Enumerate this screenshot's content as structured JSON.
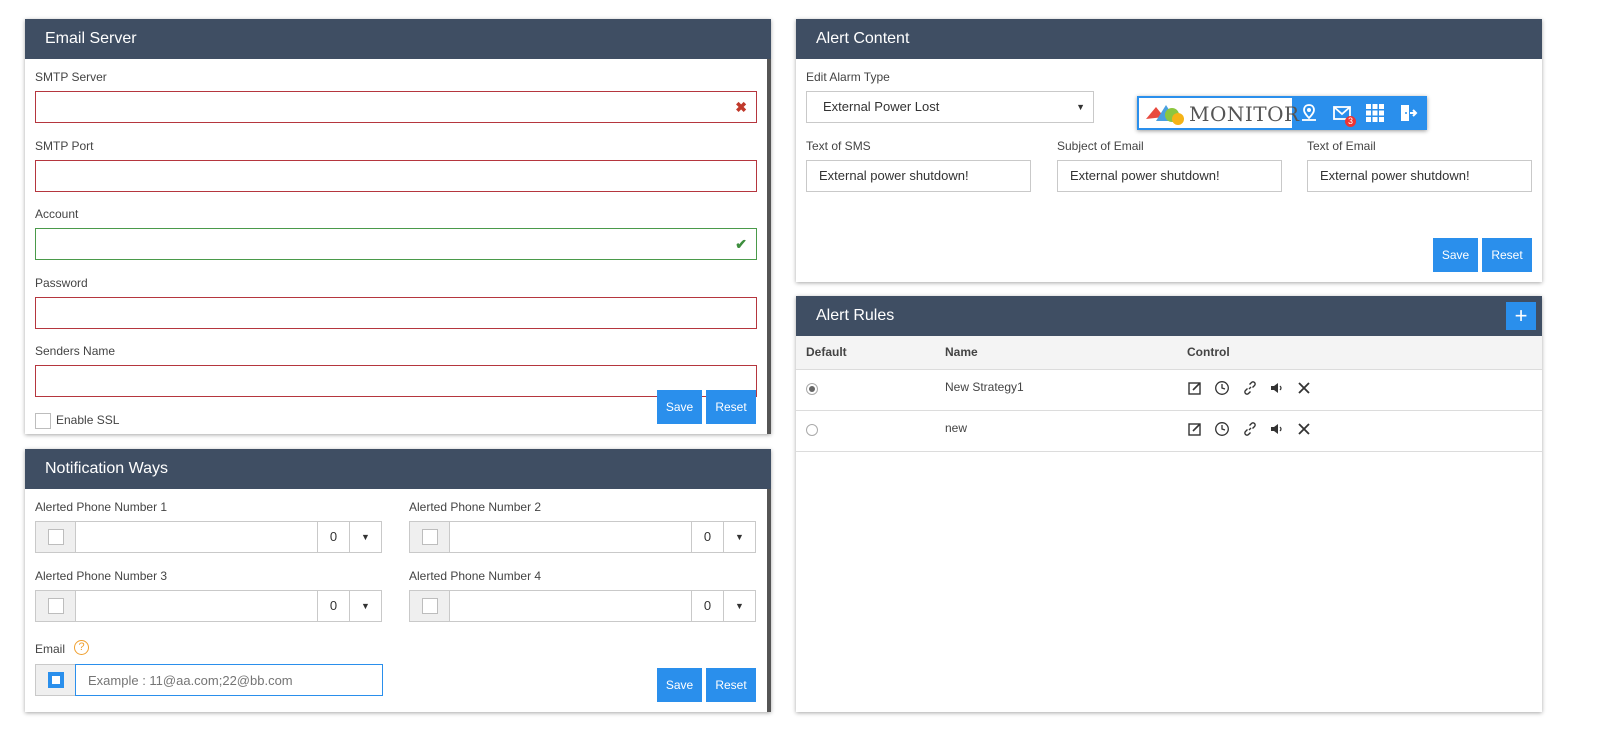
{
  "email_server": {
    "title": "Email Server",
    "fields": [
      {
        "label": "SMTP Server",
        "value": ""
      },
      {
        "label": "SMTP Port",
        "value": ""
      },
      {
        "label": "Account",
        "value": ""
      },
      {
        "label": "Password",
        "value": ""
      },
      {
        "label": "Senders Name",
        "value": ""
      }
    ],
    "ssl_label": "Enable SSL",
    "save": "Save",
    "reset": "Reset"
  },
  "notification": {
    "title": "Notification Ways",
    "phones": [
      {
        "label": "Alerted Phone Number 1",
        "value": "",
        "count": "0"
      },
      {
        "label": "Alerted Phone Number 2",
        "value": "",
        "count": "0"
      },
      {
        "label": "Alerted Phone Number 3",
        "value": "",
        "count": "0"
      },
      {
        "label": "Alerted Phone Number 4",
        "value": "",
        "count": "0"
      }
    ],
    "email_label": "Email",
    "email_help": "?",
    "email_placeholder": "Example : 11@aa.com;22@bb.com",
    "save": "Save",
    "reset": "Reset"
  },
  "alert_content": {
    "title": "Alert Content",
    "alarm_type_label": "Edit Alarm Type",
    "alarm_type_value": "External Power Lost",
    "sms_label": "Text of SMS",
    "sms_value": "External power shutdown!",
    "subject_label": "Subject of Email",
    "subject_value": "External power shutdown!",
    "email_text_label": "Text of Email",
    "email_text_value": "External power shutdown!",
    "save": "Save",
    "reset": "Reset"
  },
  "monitor_toolbar": {
    "logo_text": "MONITOR",
    "mail_badge": "3",
    "icons": [
      "map-pin-icon",
      "mail-icon",
      "grid-icon",
      "logout-icon"
    ],
    "accent": "#2a8fec"
  },
  "alert_rules": {
    "title": "Alert Rules",
    "add": "+",
    "columns": [
      "Default",
      "Name",
      "Control"
    ],
    "rows": [
      {
        "default": true,
        "name": "New Strategy1"
      },
      {
        "default": false,
        "name": "new"
      }
    ],
    "control_icons": [
      "edit-icon",
      "clock-icon",
      "link-icon",
      "speaker-icon",
      "delete-icon"
    ]
  },
  "colors": {
    "header": "#3f4e63",
    "button": "#2a8fec",
    "error_border": "#b5363e",
    "success_border": "#4a9a4a"
  }
}
